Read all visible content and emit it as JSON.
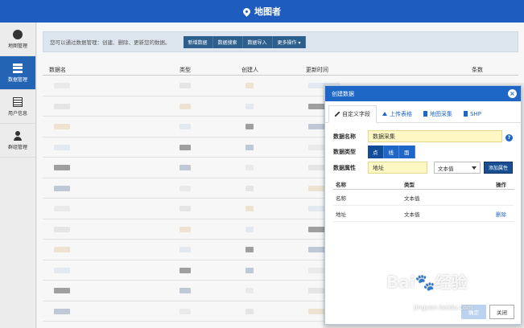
{
  "app": {
    "title": "地图者"
  },
  "sidebar": {
    "items": [
      {
        "label": "地图管理",
        "icon": "globe-icon"
      },
      {
        "label": "数据管理",
        "icon": "database-icon",
        "active": true
      },
      {
        "label": "用户信息",
        "icon": "document-icon"
      },
      {
        "label": "群组管理",
        "icon": "user-icon"
      }
    ]
  },
  "main": {
    "info_text": "您可以通过数据管理：创建、删除、更新您的数据。",
    "buttons": [
      "新增数据",
      "数据搜索",
      "数据导入",
      "更多操作 ▾"
    ],
    "columns": [
      "数据名",
      "类型",
      "创建人",
      "更新时间",
      "条数"
    ]
  },
  "modal": {
    "title": "创建数据",
    "close": "×",
    "tabs": [
      "自定义字段",
      "上传表格",
      "地图采集",
      "SHP"
    ],
    "fields": {
      "name_label": "数据名称",
      "name_value": "数据采集",
      "help": "?",
      "type_label": "数据类型",
      "type_options": [
        "点",
        "线",
        "面"
      ],
      "attr_label": "数据属性",
      "attr_value": "地址",
      "attr_type": "文本值",
      "add_attr": "添加属性"
    },
    "table": {
      "headers": [
        "名称",
        "类型",
        "操作"
      ],
      "rows": [
        {
          "name": "名称",
          "type": "文本值",
          "action": ""
        },
        {
          "name": "地址",
          "type": "文本值",
          "action": "删除"
        }
      ]
    },
    "ok": "确定",
    "close_btn": "关闭"
  },
  "watermark": {
    "main": "Bai🐾经验",
    "sub": "jingyan.baidu.com"
  },
  "colors": {
    "primary": "#1e5cc0",
    "sidebar_active": "#2464b4",
    "highlight": "#fdf7c3"
  }
}
